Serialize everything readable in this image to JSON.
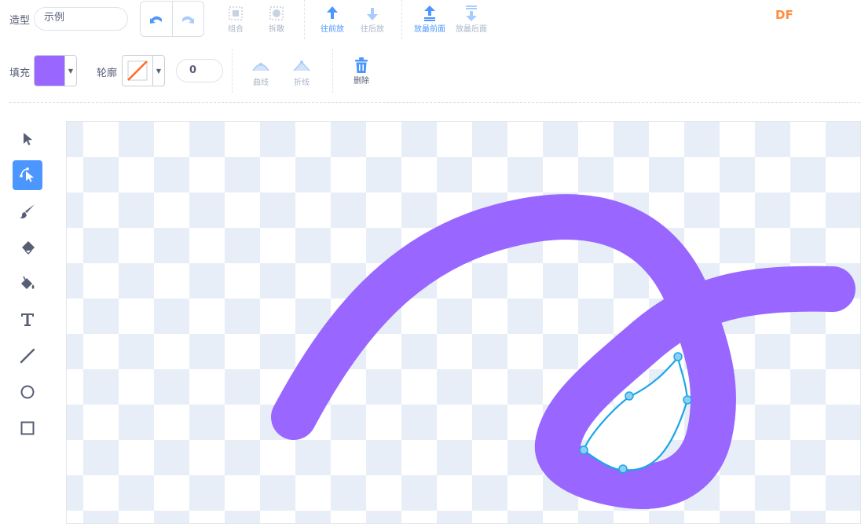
{
  "toolbar": {
    "costume_label": "造型",
    "costume_name": "示例",
    "group_label": "组合",
    "ungroup_label": "拆散",
    "forward_label": "往前放",
    "backward_label": "往后放",
    "front_label": "放最前面",
    "back_label": "放最后面",
    "brand": "DF"
  },
  "style_row": {
    "fill_label": "填充",
    "fill_color": "#9966ff",
    "outline_label": "轮廓",
    "outline_width": "0",
    "curve_label": "曲线",
    "corner_label": "折线",
    "delete_label": "删除"
  },
  "left_tools": [
    {
      "name": "select-tool",
      "icon": "arrow-icon"
    },
    {
      "name": "reshape-tool",
      "icon": "reshape-icon",
      "active": true
    },
    {
      "name": "brush-tool",
      "icon": "brush-icon"
    },
    {
      "name": "eraser-tool",
      "icon": "eraser-icon"
    },
    {
      "name": "fill-tool",
      "icon": "paint-bucket-icon"
    },
    {
      "name": "text-tool",
      "icon": "text-icon"
    },
    {
      "name": "line-tool",
      "icon": "line-icon"
    },
    {
      "name": "circle-tool",
      "icon": "circle-icon"
    },
    {
      "name": "rect-tool",
      "icon": "rectangle-icon"
    }
  ],
  "colors": {
    "accent": "#4c97ff",
    "stroke": "#9966ff",
    "selection": "#1ca6e8"
  }
}
